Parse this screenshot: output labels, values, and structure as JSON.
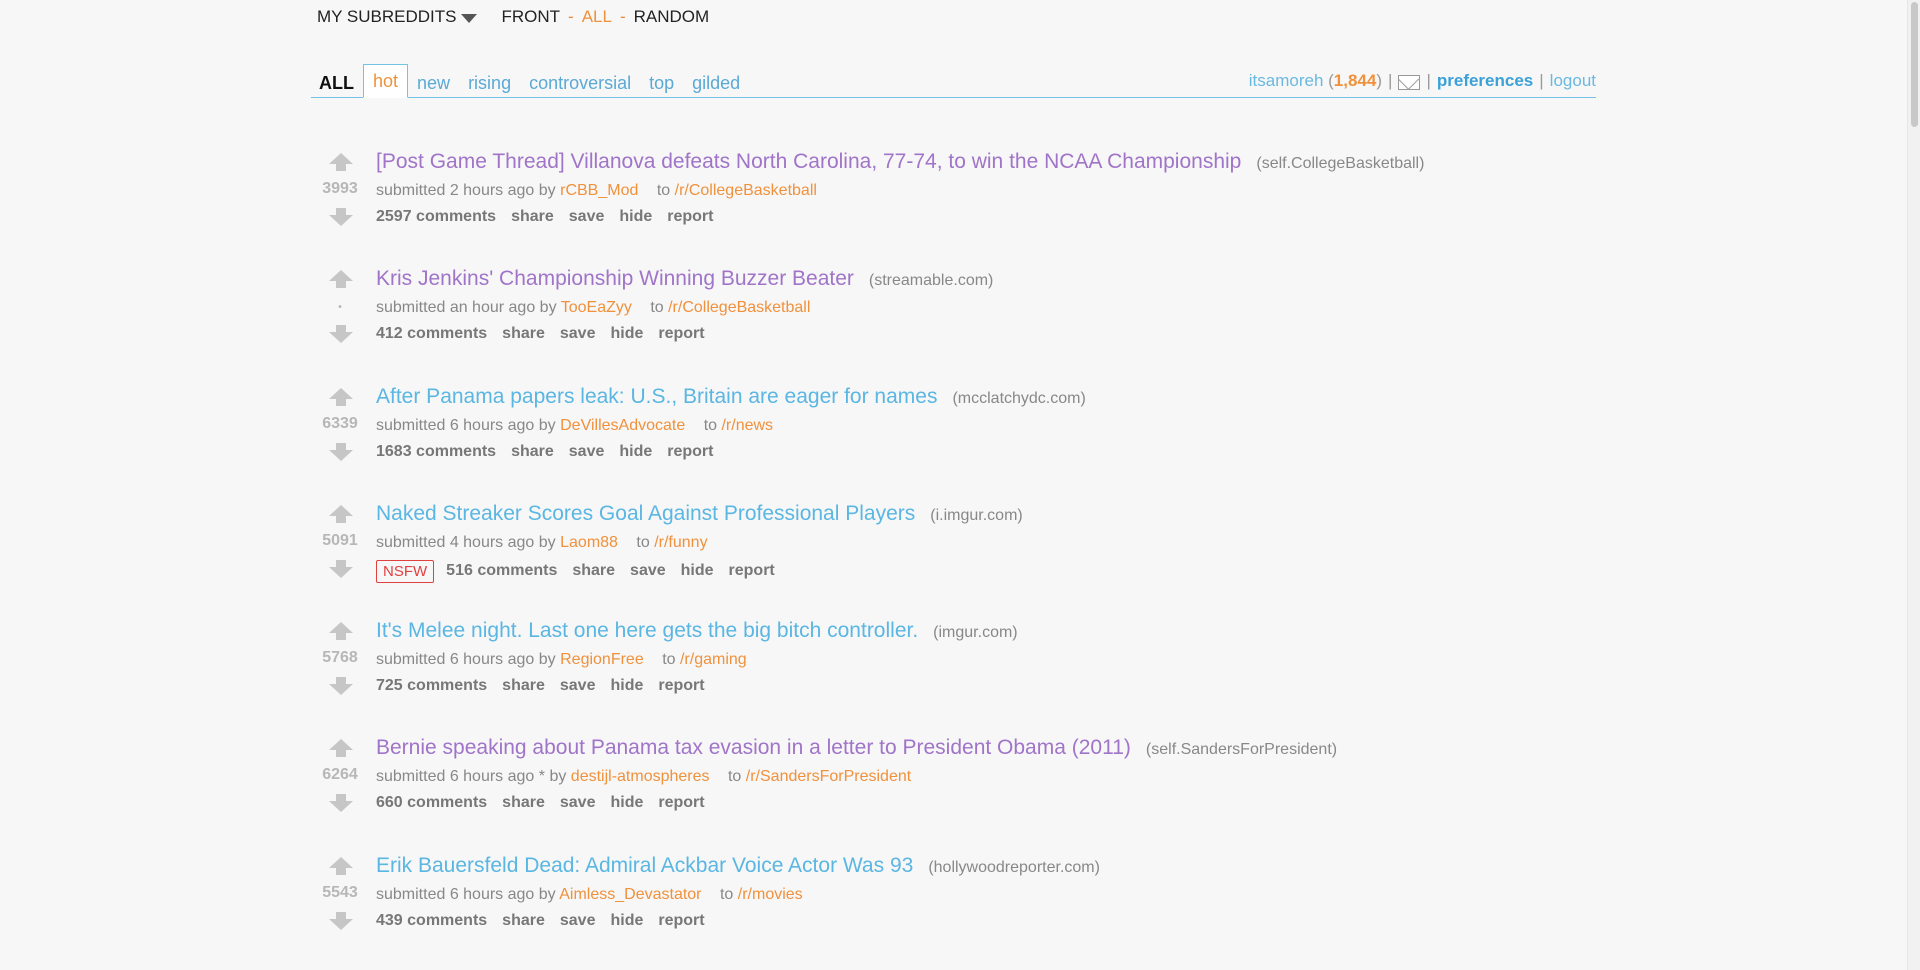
{
  "topbar": {
    "my_subreddits": "MY SUBREDDITS",
    "front": "FRONT",
    "all": "ALL",
    "random": "RANDOM",
    "separator": "-"
  },
  "tabbar": {
    "section_label": "ALL",
    "tabs": [
      "hot",
      "new",
      "rising",
      "controversial",
      "top",
      "gilded"
    ],
    "selected_tab": "hot"
  },
  "user": {
    "username": "itsamoreh",
    "karma": "1,844",
    "preferences": "preferences",
    "logout": "logout",
    "separator": "|"
  },
  "posts": [
    {
      "score": "3993",
      "title": "[Post Game Thread] Villanova defeats North Carolina, 77-74, to win the NCAA Championship",
      "domain": "(self.CollegeBasketball)",
      "visited": true,
      "submitted": "submitted 2 hours ago by",
      "author": "rCBB_Mod",
      "to": "to",
      "subreddit": "/r/CollegeBasketball",
      "nsfw": "",
      "comments": "2597 comments"
    },
    {
      "score": "•",
      "title": "Kris Jenkins' Championship Winning Buzzer Beater",
      "domain": "(streamable.com)",
      "visited": true,
      "submitted": "submitted an hour ago by",
      "author": "TooEaZyy",
      "to": "to",
      "subreddit": "/r/CollegeBasketball",
      "nsfw": "",
      "comments": "412 comments"
    },
    {
      "score": "6339",
      "title": "After Panama papers leak: U.S., Britain are eager for names",
      "domain": "(mcclatchydc.com)",
      "visited": false,
      "submitted": "submitted 6 hours ago by",
      "author": "DeVillesAdvocate",
      "to": "to",
      "subreddit": "/r/news",
      "nsfw": "",
      "comments": "1683 comments"
    },
    {
      "score": "5091",
      "title": "Naked Streaker Scores Goal Against Professional Players",
      "domain": "(i.imgur.com)",
      "visited": false,
      "submitted": "submitted 4 hours ago by",
      "author": "Laom88",
      "to": "to",
      "subreddit": "/r/funny",
      "nsfw": "NSFW",
      "comments": "516 comments"
    },
    {
      "score": "5768",
      "title": "It's Melee night. Last one here gets the big bitch controller.",
      "domain": "(imgur.com)",
      "visited": false,
      "submitted": "submitted 6 hours ago by",
      "author": "RegionFree",
      "to": "to",
      "subreddit": "/r/gaming",
      "nsfw": "",
      "comments": "725 comments"
    },
    {
      "score": "6264",
      "title": "Bernie speaking about Panama tax evasion in a letter to President Obama (2011)",
      "domain": "(self.SandersForPresident)",
      "visited": true,
      "submitted": "submitted 6 hours ago * by",
      "author": "destijl-atmospheres",
      "to": "to",
      "subreddit": "/r/SandersForPresident",
      "nsfw": "",
      "comments": "660 comments"
    },
    {
      "score": "5543",
      "title": "Erik Bauersfeld Dead: Admiral Ackbar Voice Actor Was 93",
      "domain": "(hollywoodreporter.com)",
      "visited": false,
      "submitted": "submitted 6 hours ago by",
      "author": "Aimless_Devastator",
      "to": "to",
      "subreddit": "/r/movies",
      "nsfw": "",
      "comments": "439 comments"
    }
  ],
  "actions": {
    "share": "share",
    "save": "save",
    "hide": "hide",
    "report": "report"
  },
  "icons": {
    "upvote": "upvote-arrow-icon",
    "downvote": "downvote-arrow-icon",
    "mail": "mail-envelope-icon",
    "dropdown": "chevron-down-icon"
  },
  "colors": {
    "visited_title": "#a074c8",
    "unvisited_title": "#5ab6e2",
    "accent_orange": "#f0913c",
    "link_blue": "#3ba1d6",
    "nsfw_red": "#e0413f"
  }
}
